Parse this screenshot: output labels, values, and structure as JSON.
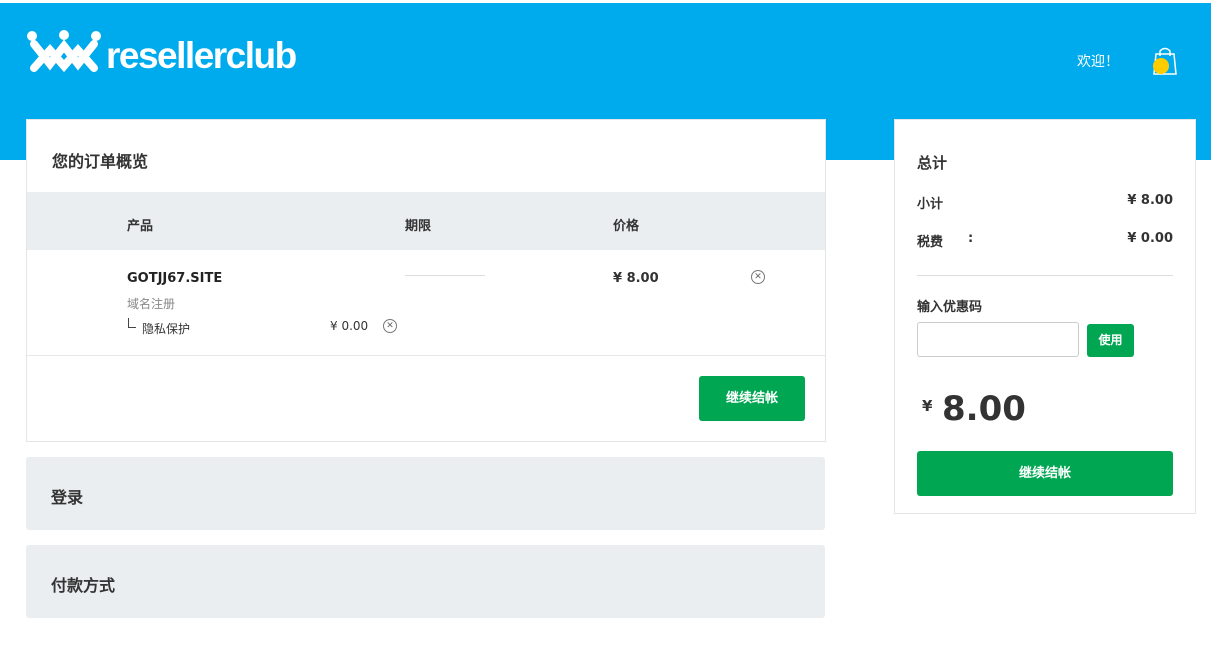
{
  "header": {
    "brand": "resellerclub",
    "welcome": "欢迎！"
  },
  "order": {
    "title": "您的订单概览",
    "columns": {
      "product": "产品",
      "term": "期限",
      "price": "价格"
    },
    "item": {
      "name": "GOTJJ67.SITE",
      "type": "域名注册",
      "price": "¥ 8.00",
      "addon": {
        "label": "隐私保护",
        "price": "¥ 0.00"
      }
    },
    "continue_label": "继续结帐"
  },
  "sections": {
    "login": "登录",
    "payment": "付款方式"
  },
  "summary": {
    "title": "总计",
    "subtotal_label": "小计",
    "subtotal_value": "¥ 8.00",
    "tax_label": "税费",
    "tax_colon": ":",
    "tax_value": "¥ 0.00",
    "coupon_label": "输入优惠码",
    "coupon_value": "",
    "apply_label": "使用",
    "total_currency": "¥",
    "total_amount": "8.00",
    "continue_label": "继续结帐"
  },
  "colors": {
    "header_bg": "#00abed",
    "button_green": "#00a651",
    "cart_badge": "#ffcc00"
  },
  "icons": [
    "resellerclub-logo-icon",
    "shopping-bag-icon",
    "remove-circle-x-icon"
  ]
}
